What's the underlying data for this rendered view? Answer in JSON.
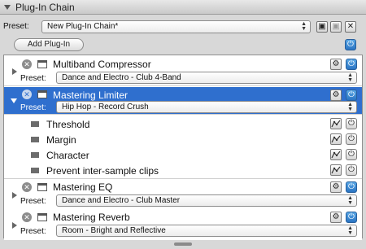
{
  "window": {
    "title": "Plug-In Chain"
  },
  "toolbar": {
    "preset_label": "Preset:",
    "preset_value": "New Plug-In Chain*",
    "add_plugin_label": "Add Plug-In"
  },
  "chain": [
    {
      "name": "Multiband Compressor",
      "preset_label": "Preset:",
      "preset": "Dance and Electro - Club 4-Band",
      "expanded": false,
      "selected": false
    },
    {
      "name": "Mastering Limiter",
      "preset_label": "Preset:",
      "preset": "Hip Hop - Record Crush",
      "expanded": true,
      "selected": true
    },
    {
      "name": "Mastering EQ",
      "preset_label": "Preset:",
      "preset": "Dance and Electro - Club Master",
      "expanded": false,
      "selected": false
    },
    {
      "name": "Mastering Reverb",
      "preset_label": "Preset:",
      "preset": "Room - Bright and Reflective",
      "expanded": false,
      "selected": false
    }
  ],
  "limiter_params": [
    {
      "name": "Threshold"
    },
    {
      "name": "Margin"
    },
    {
      "name": "Character"
    },
    {
      "name": "Prevent inter-sample clips"
    }
  ],
  "icons": {
    "remove": "x-circle-icon",
    "window": "plugin-window-icon",
    "settings": "gear-icon",
    "power": "power-icon",
    "automation": "automation-icon",
    "save": "save-icon",
    "close": "close-icon"
  },
  "colors": {
    "selection": "#2f6fce",
    "power_on": "#2a74c2"
  }
}
